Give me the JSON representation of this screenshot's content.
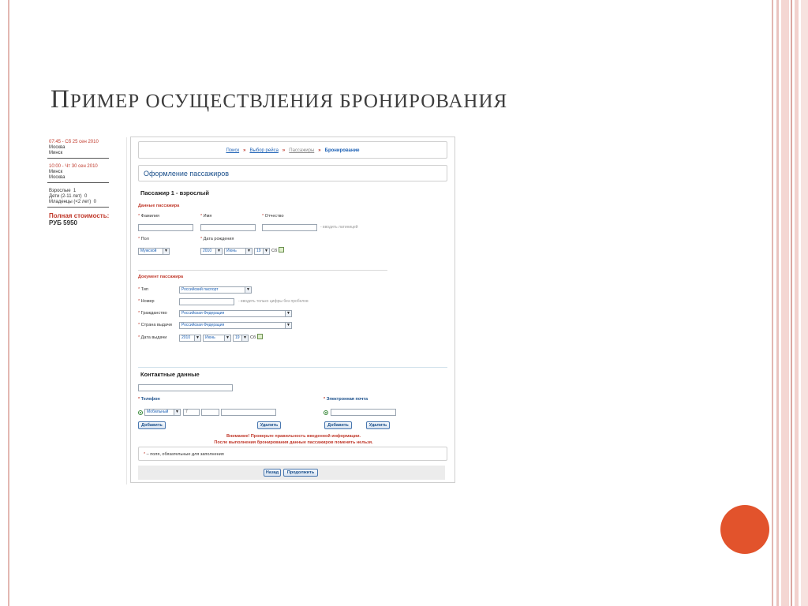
{
  "slide": {
    "title_cap": "П",
    "title_rest": "ример осуществления бронирования",
    "accent_color": "#e2532c"
  },
  "left_panel": {
    "flight1": {
      "time": "07:45 - Сб 25 сен 2010",
      "from": "Москва",
      "to": "Минск"
    },
    "flight2": {
      "time": "10:00 - Чт 30 сен 2010",
      "from": "Минск",
      "to": "Москва"
    },
    "passengers": [
      {
        "label": "Взрослые",
        "count": "1"
      },
      {
        "label": "Дети (2-11 лет)",
        "count": "0"
      },
      {
        "label": "Младенцы (<2 лет)",
        "count": "0"
      }
    ],
    "total_label": "Полная стоимость:",
    "total_value": "РУБ 5950"
  },
  "breadcrumb": {
    "items": [
      "Поиск",
      "Выбор рейса",
      "Пассажиры",
      "Бронирование"
    ],
    "sep": "»"
  },
  "form": {
    "section_title": "Оформление пассажиров",
    "passenger_title": "Пассажир 1 - взрослый",
    "passenger_data_head": "Данные пассажира",
    "lastname_label": "Фамилия",
    "firstname_label": "Имя",
    "patronymic_label": "Отчество",
    "latin_hint": "- вводить латиницей",
    "gender_label": "Пол",
    "gender_value": "Мужской",
    "birthdate_label": "Дата рождения",
    "birth_year": "2010",
    "birth_month": "Июнь",
    "birth_day": "19",
    "birth_weekday": "Сб",
    "document_head": "Документ пассажира",
    "doc_type_label": "Тип",
    "doc_type_value": "Российский паспорт",
    "doc_number_label": "Номер",
    "doc_number_hint": "- вводить только цифры без пробелов",
    "citizenship_label": "Гражданство",
    "citizenship_value": "Российская Федерация",
    "issue_country_label": "Страна выдачи",
    "issue_country_value": "Российская Федерация",
    "issue_date_label": "Дата выдачи",
    "issue_year": "2010",
    "issue_month": "Июнь",
    "issue_day": "19",
    "issue_weekday": "Сб"
  },
  "contacts": {
    "title": "Контактные данные",
    "phone_label": "Телефон",
    "phone_type": "Мобильный",
    "phone_code": "7",
    "email_label": "Электронная почта",
    "add_label": "Добавить",
    "remove_label": "Удалить",
    "warning_line1": "Внимание! Проверьте правильность введенной информации.",
    "warning_line2": "После выполнения бронирования данные пассажиров поменять нельзя.",
    "required_note": "– поля, обязательные для заполнения",
    "back_label": "Назад",
    "continue_label": "Продолжить"
  }
}
